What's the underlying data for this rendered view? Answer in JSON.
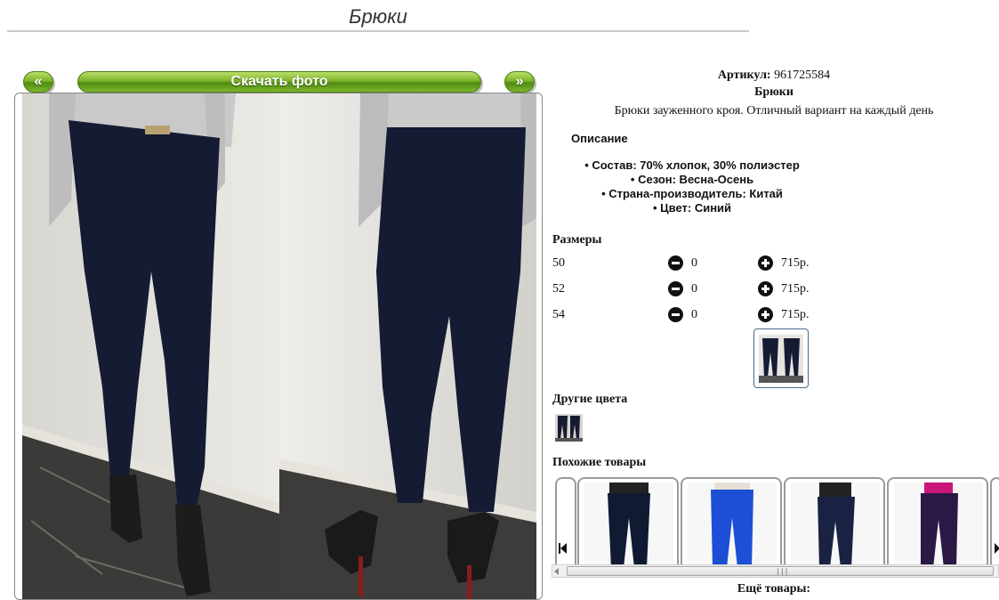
{
  "page": {
    "title": "Брюки"
  },
  "gallery": {
    "prev_label": "«",
    "next_label": "»",
    "download_label": "Скачать фото"
  },
  "product": {
    "sku_label": "Артикул:",
    "sku_value": "961725584",
    "name": "Брюки",
    "short_description": "Брюки зауженного кроя. Отличный вариант на каждый день",
    "description_heading": "Описание",
    "specs": [
      "• Состав: 70% хлопок, 30% полиэстер",
      "• Сезон: Весна-Осень",
      "• Страна-производитель: Китай",
      "• Цвет: Синий"
    ]
  },
  "sizes": {
    "heading": "Размеры",
    "rows": [
      {
        "size": "50",
        "qty": "0",
        "price": "715р."
      },
      {
        "size": "52",
        "qty": "0",
        "price": "715р."
      },
      {
        "size": "54",
        "qty": "0",
        "price": "715р."
      }
    ]
  },
  "other_colors": {
    "heading": "Другие цвета"
  },
  "similar": {
    "heading": "Похожие товары",
    "items": [
      {
        "color": "#101a33"
      },
      {
        "color": "#1d4fd6"
      },
      {
        "color": "#1a2244"
      },
      {
        "color": "#2a1845"
      }
    ]
  },
  "more_label": "Ещё товары:",
  "colors": {
    "green_button": "#6fa622",
    "pants_navy": "#141b33",
    "frame_border": "#888888"
  }
}
